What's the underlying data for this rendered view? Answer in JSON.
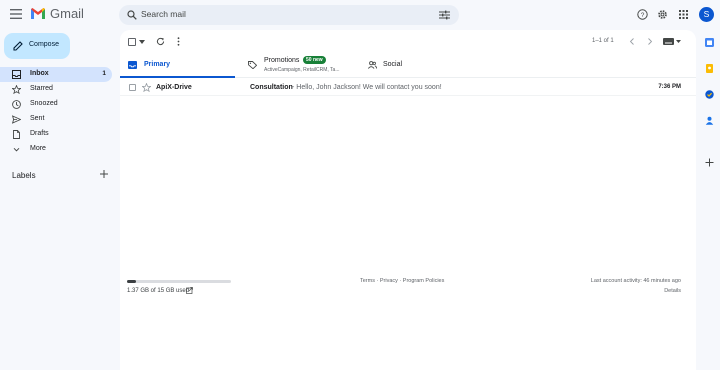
{
  "app": {
    "name": "Gmail"
  },
  "search": {
    "placeholder": "Search mail"
  },
  "account": {
    "avatar_letter": "S"
  },
  "compose": {
    "label": "Compose"
  },
  "nav": [
    {
      "label": "Inbox",
      "count": "1",
      "icon": "inbox-icon",
      "active": true
    },
    {
      "label": "Starred",
      "count": "",
      "icon": "star-icon"
    },
    {
      "label": "Snoozed",
      "count": "",
      "icon": "clock-icon"
    },
    {
      "label": "Sent",
      "count": "",
      "icon": "send-icon"
    },
    {
      "label": "Drafts",
      "count": "",
      "icon": "draft-icon"
    },
    {
      "label": "More",
      "count": "",
      "icon": "chevron-down-icon"
    }
  ],
  "labels": {
    "title": "Labels"
  },
  "toolbar": {
    "pager": "1–1 of 1"
  },
  "tabs": {
    "primary": {
      "label": "Primary"
    },
    "promotions": {
      "label": "Promotions",
      "badge": "50 new",
      "sub": "ActiveCampaign, RetailCRM, Ta..."
    },
    "social": {
      "label": "Social"
    }
  },
  "emails": [
    {
      "sender": "ApiX-Drive",
      "subject": "Consultation",
      "snippet": " - Hello, John Jackson! We will contact you soon!",
      "time": "7:36 PM"
    }
  ],
  "storage": {
    "text": "1.37 GB of 15 GB used",
    "used_fraction": 0.09
  },
  "footer": {
    "terms": "Terms",
    "sep1": " · ",
    "privacy": "Privacy",
    "sep2": " · ",
    "policies": "Program Policies",
    "activity": "Last account activity: 46 minutes ago",
    "details": "Details"
  },
  "colors": {
    "accent": "#0b57d0",
    "compose_bg": "#c2e7ff",
    "badge_green": "#188038",
    "background": "#f6f8fc"
  }
}
